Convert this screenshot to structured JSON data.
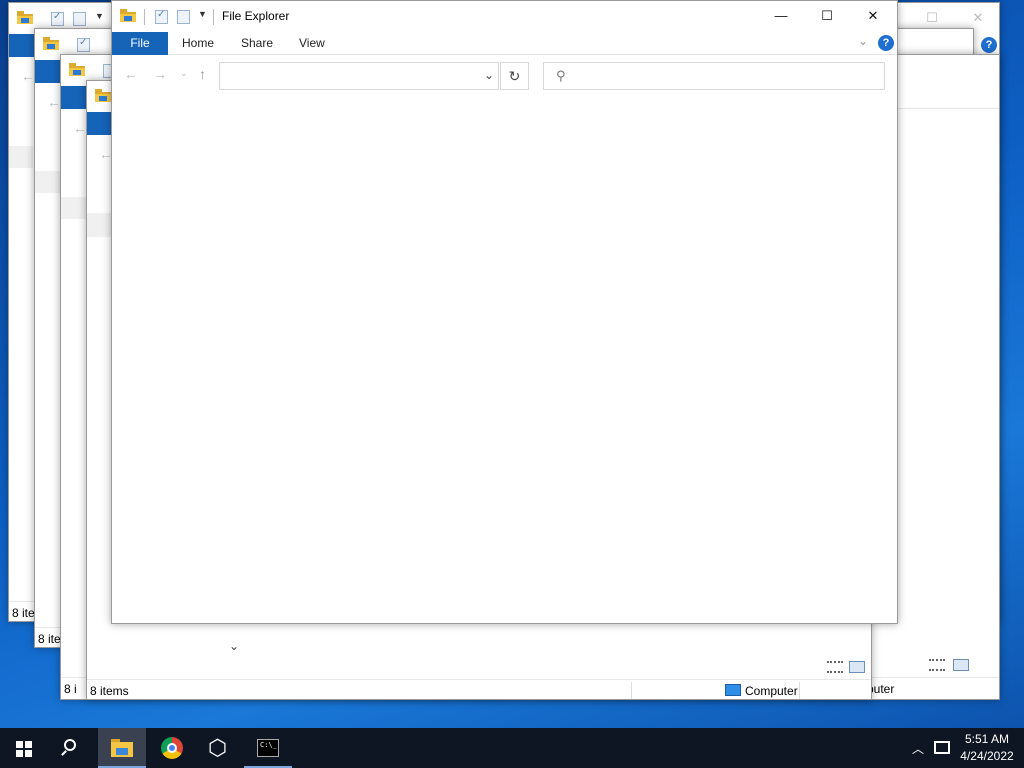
{
  "window": {
    "title": "File Explorer",
    "ribbon_tabs": {
      "file": "File",
      "home": "Home",
      "share": "Share",
      "view": "View"
    },
    "help_label": "?",
    "caption": {
      "minimize": "—",
      "maximize": "☐",
      "close": "✕"
    },
    "nav": {
      "back": "←",
      "forward": "→",
      "recent": "⌄",
      "up": "↑",
      "refresh": "↻",
      "address_dropdown": "⌄"
    }
  },
  "background_windows": {
    "status_items": "8 items",
    "status_items_partial_1": "8 ite",
    "status_items_partial_2": "8 i",
    "status_computer": "Computer",
    "status_computer_partial": "puter",
    "file_tab_partial": "F"
  },
  "taskbar": {
    "apps": [
      "start",
      "search",
      "file-explorer",
      "chrome",
      "package-3d",
      "command-prompt"
    ],
    "clock": {
      "time": "5:51 AM",
      "date": "4/24/2022"
    }
  },
  "colors": {
    "accent": "#1664b8",
    "taskbar": "#0f1623",
    "desktop": "#0d5fc4"
  }
}
